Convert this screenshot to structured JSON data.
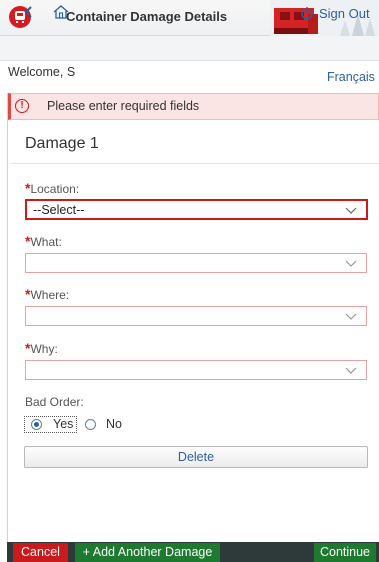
{
  "header": {
    "title": "Container Damage Details"
  },
  "nav": {
    "sign_out_label": "Sign Out"
  },
  "welcome_text": "Welcome, S",
  "language_link": "Français",
  "message": {
    "text": "Please enter required fields",
    "icon": "!"
  },
  "section_title": "Damage 1",
  "form": {
    "location": {
      "required_mark": "*",
      "label": "Location:",
      "value": "--Select--"
    },
    "what": {
      "required_mark": "*",
      "label": "What:",
      "value": ""
    },
    "where": {
      "required_mark": "*",
      "label": "Where:",
      "value": ""
    },
    "why": {
      "required_mark": "*",
      "label": "Why:",
      "value": ""
    },
    "bad_order": {
      "label": "Bad Order:",
      "options": [
        {
          "label": "Yes",
          "selected": true
        },
        {
          "label": "No",
          "selected": false
        }
      ]
    }
  },
  "delete_label": "Delete",
  "footer": {
    "cancel_label": "Cancel",
    "add_label": "+ Add Another Damage",
    "continue_label": "Continue"
  },
  "colors": {
    "accent_red": "#cc1919",
    "link_blue": "#2b5f9e",
    "footer_bg": "#2e3a3a",
    "cancel_bg": "#c91b1b",
    "action_green": "#1d7a2e"
  }
}
